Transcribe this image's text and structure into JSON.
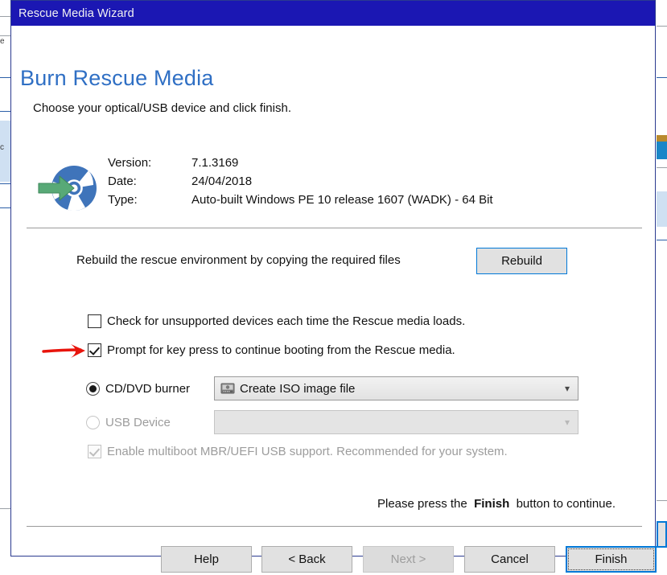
{
  "window": {
    "title": "Rescue Media Wizard"
  },
  "page": {
    "heading": "Burn Rescue Media",
    "subheading": "Choose your optical/USB device and click finish."
  },
  "media_info": {
    "icon": "rescue-disc-icon",
    "rows": [
      {
        "label": "Version:",
        "value": "7.1.3169"
      },
      {
        "label": "Date:",
        "value": "24/04/2018"
      },
      {
        "label": "Type:",
        "value": "Auto-built Windows PE 10 release 1607 (WADK) - 64 Bit"
      }
    ]
  },
  "rebuild": {
    "description": "Rebuild the rescue environment by copying the required files",
    "button_label": "Rebuild"
  },
  "options": {
    "check_unsupported": {
      "label": "Check for unsupported devices each time the Rescue media loads.",
      "checked": false,
      "enabled": true
    },
    "prompt_key_press": {
      "label": "Prompt for key press to continue booting from the Rescue media.",
      "checked": true,
      "enabled": true,
      "annotation": "red-arrow-pointer"
    },
    "multiboot": {
      "label": "Enable multiboot MBR/UEFI USB support. Recommended for your system.",
      "checked": true,
      "enabled": false
    }
  },
  "device_targets": {
    "cddvd": {
      "radio_label": "CD/DVD burner",
      "selected": true,
      "enabled": true,
      "combo_value": "Create ISO image file",
      "combo_icon": "optical-drive-icon",
      "combo_arrow": "chevron-down-icon"
    },
    "usb": {
      "radio_label": "USB Device",
      "selected": false,
      "enabled": false,
      "combo_value": "",
      "combo_arrow": "chevron-down-icon"
    }
  },
  "hint": {
    "prefix": "Please press the",
    "emphasis": "Finish",
    "suffix": "button to continue."
  },
  "buttons": {
    "help": {
      "label": "Help",
      "enabled": true
    },
    "back": {
      "label": "< Back",
      "enabled": true
    },
    "next": {
      "label": "Next >",
      "enabled": false
    },
    "cancel": {
      "label": "Cancel",
      "enabled": true
    },
    "finish": {
      "label": "Finish",
      "enabled": true,
      "is_default": true
    }
  },
  "colors": {
    "title_bar": "#1b17b3",
    "heading": "#2f6fc4",
    "accent_focus": "#0078d7",
    "annotation_red": "#e8140c",
    "disc_blue": "#3f74ba",
    "arrow_green": "#58a977"
  }
}
